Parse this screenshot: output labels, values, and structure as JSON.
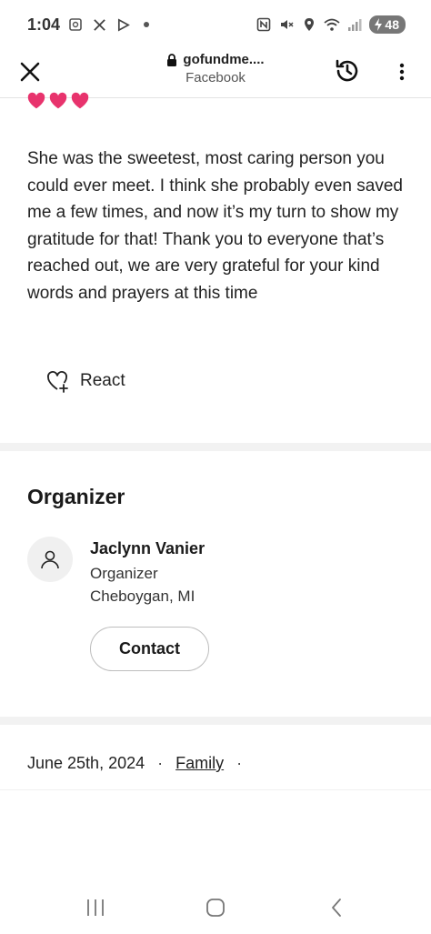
{
  "status_bar": {
    "time": "1:04",
    "battery": "48",
    "icons": [
      "screenshot-icon",
      "x-app-icon",
      "play-icon",
      "dot-icon",
      "nfc-icon",
      "mute-icon",
      "location-icon",
      "wifi-icon",
      "signal-icon",
      "battery-icon"
    ]
  },
  "browser": {
    "url": "gofundme....",
    "source": "Facebook",
    "icons": [
      "close-icon",
      "lock-icon",
      "history-icon",
      "more-icon"
    ]
  },
  "story": {
    "text": "She was the sweetest, most caring person you could ever meet. I think she probably even saved me a few times, and now it’s my turn to show my gratitude for that! Thank you to everyone that’s reached out, we are very grateful for your kind words and prayers at this time",
    "react_label": "React"
  },
  "organizer": {
    "heading": "Organizer",
    "name": "Jaclynn Vanier",
    "role": "Organizer",
    "location": "Cheboygan, MI",
    "contact_label": "Contact"
  },
  "meta": {
    "date": "June 25th, 2024",
    "separator": "·",
    "category": "Family"
  },
  "colors": {
    "heart": "#e8336d",
    "divider": "#f2f2f2",
    "text": "#1a1a1a"
  }
}
